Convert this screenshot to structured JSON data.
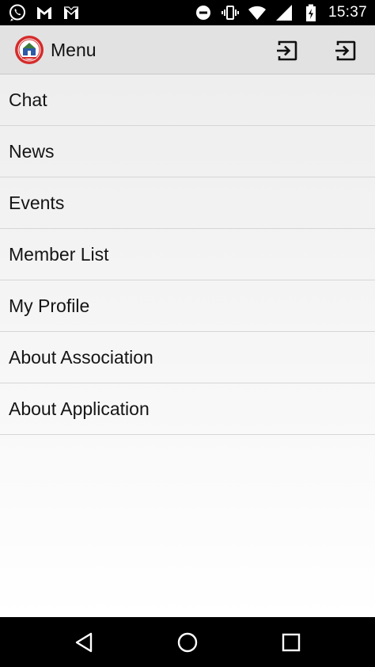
{
  "status_bar": {
    "time": "15:37",
    "left_icons": [
      "whatsapp-icon",
      "gmail-icon",
      "mail-m-icon"
    ],
    "right_icons": [
      "do-not-disturb-icon",
      "vibrate-icon",
      "wifi-icon",
      "signal-icon",
      "battery-charging-icon"
    ]
  },
  "app_bar": {
    "title": "Menu",
    "logo_icon": "association-emblem-icon",
    "actions": [
      {
        "icon": "exit-to-app-icon"
      },
      {
        "icon": "exit-to-app-icon"
      }
    ]
  },
  "menu": {
    "items": [
      {
        "label": "Chat"
      },
      {
        "label": "News"
      },
      {
        "label": "Events"
      },
      {
        "label": "Member List"
      },
      {
        "label": "My Profile"
      },
      {
        "label": "About Association"
      },
      {
        "label": "About Application"
      }
    ]
  },
  "nav_bar": {
    "buttons": [
      "back-icon",
      "home-icon",
      "recents-icon"
    ]
  },
  "colors": {
    "status_bar_bg": "#000000",
    "app_bar_bg": "#e2e2e2",
    "logo_red": "#d52b2b",
    "divider": "#d6d6d6",
    "text": "#151515"
  }
}
